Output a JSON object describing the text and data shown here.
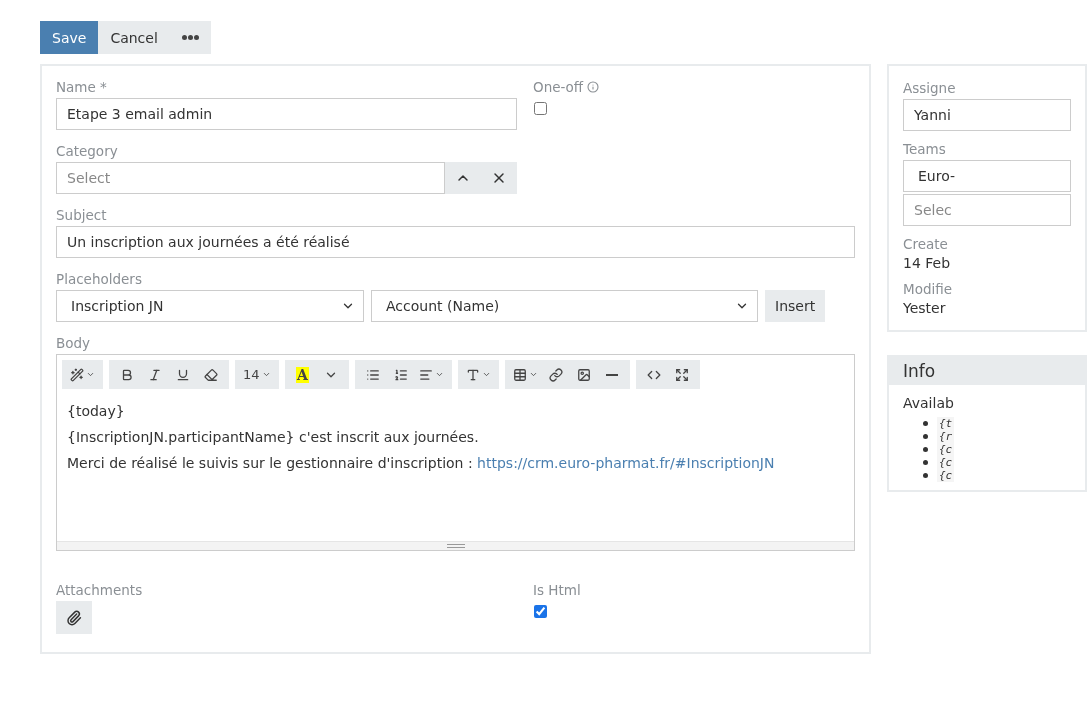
{
  "actions": [
    {
      "kind": "primary",
      "label": "Save"
    },
    {
      "kind": "default",
      "label": "Cancel"
    },
    {
      "kind": "more"
    }
  ],
  "name": {
    "label": "Name *",
    "value": "Etape 3 email admin"
  },
  "one_off": {
    "label": "One-off",
    "checked": false
  },
  "category": {
    "label": "Category",
    "placeholder": "Select"
  },
  "subject": {
    "label": "Subject",
    "value": "Un inscription aux journées a été réalisé"
  },
  "placeholders": {
    "label": "Placeholders",
    "entity": "Inscription JN",
    "field": "Account (Name)",
    "button": "Insert"
  },
  "body": {
    "label": "Body",
    "font_size": "14",
    "color_letter": "A",
    "lines": [
      {
        "text": "{today}"
      },
      {
        "text": "{InscriptionJN.participantName} c'est inscrit aux journées."
      },
      {
        "text": "Merci de réalisé le suivis sur le gestionnaire d'inscription : ",
        "link": "https://crm.euro-pharmat.fr/#InscriptionJN"
      }
    ]
  },
  "attachments": {
    "label": "Attachments"
  },
  "is_html": {
    "label": "Is Html",
    "checked": true
  },
  "side": {
    "assigned_label": "Assigne",
    "assigned_value": "Yanni",
    "teams_label": "Teams",
    "team": "Euro-",
    "teams_placeholder": "Selec",
    "created_label": "Create",
    "created_value": "14 Feb",
    "modified_label": "Modifie",
    "modified_value": "Yester"
  },
  "info": {
    "title": "Info",
    "text": "Availab",
    "codes": [
      "{t",
      "{r",
      "{c",
      "{c",
      "{c"
    ]
  }
}
